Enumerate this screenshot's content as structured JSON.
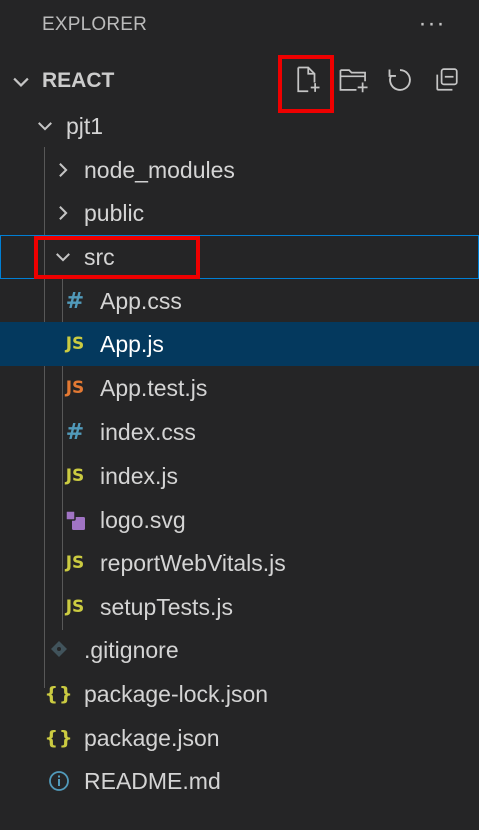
{
  "explorer": {
    "title": "EXPLORER",
    "more_actions_label": "···"
  },
  "section": {
    "name": "REACT",
    "expanded": true,
    "actions": [
      "new-file",
      "new-folder",
      "refresh",
      "collapse-all"
    ]
  },
  "tree": {
    "project": "pjt1",
    "node_modules": "node_modules",
    "public": "public",
    "src": "src",
    "src_files": [
      {
        "name": "App.css",
        "icon": "css-icon",
        "badge": "#"
      },
      {
        "name": "App.js",
        "icon": "js-icon",
        "badge": "JS"
      },
      {
        "name": "App.test.js",
        "icon": "test-js-icon",
        "badge": "JS"
      },
      {
        "name": "index.css",
        "icon": "css-icon",
        "badge": "#"
      },
      {
        "name": "index.js",
        "icon": "js-icon",
        "badge": "JS"
      },
      {
        "name": "logo.svg",
        "icon": "svg-icon",
        "badge": ""
      },
      {
        "name": "reportWebVitals.js",
        "icon": "js-icon",
        "badge": "JS"
      },
      {
        "name": "setupTests.js",
        "icon": "js-icon",
        "badge": "JS"
      }
    ],
    "root_files": [
      {
        "name": ".gitignore",
        "icon": "git-icon",
        "badge": ""
      },
      {
        "name": "package-lock.json",
        "icon": "json-icon",
        "badge": "{}"
      },
      {
        "name": "package.json",
        "icon": "json-icon",
        "badge": "{}"
      },
      {
        "name": "README.md",
        "icon": "info-icon",
        "badge": ""
      }
    ],
    "selected_file": "App.js"
  },
  "colors": {
    "background": "#252526",
    "selection": "#04395e",
    "focus_border": "#007fd4",
    "highlight_box": "#ee0000",
    "js": "#cbcb41",
    "css": "#519aba",
    "test": "#e37933"
  }
}
